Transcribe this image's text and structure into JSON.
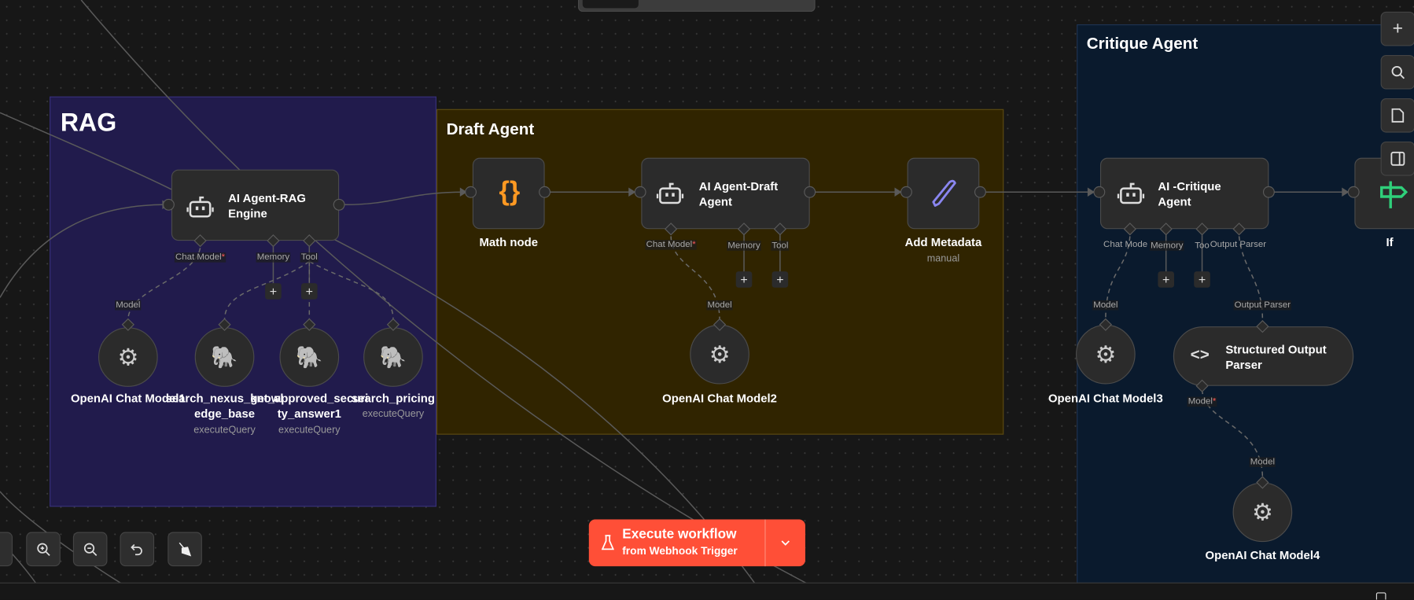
{
  "groups": {
    "rag": "RAG",
    "draft": "Draft Agent",
    "critique": "Critique Agent"
  },
  "nodes": {
    "rag_agent": {
      "title": "AI Agent-RAG Engine",
      "ports": {
        "chat_model": "Chat Model",
        "memory": "Memory",
        "tool": "Tool"
      }
    },
    "openai1": {
      "name": "OpenAI Chat Model1",
      "port": "Model"
    },
    "search_kb": {
      "name_l1": "search_nexus_knowl",
      "name_l2": "edge_base",
      "sub": "executeQuery"
    },
    "get_approved": {
      "name_l1": "get_approved_securi",
      "name_l2": "ty_answer1",
      "sub": "executeQuery"
    },
    "search_pricing": {
      "name": "search_pricing",
      "sub": "executeQuery"
    },
    "math": {
      "name": "Math node"
    },
    "draft_agent": {
      "title": "AI Agent-Draft Agent",
      "ports": {
        "chat_model": "Chat Model",
        "memory": "Memory",
        "tool": "Tool"
      }
    },
    "openai2": {
      "name": "OpenAI Chat Model2",
      "port": "Model"
    },
    "metadata": {
      "name": "Add Metadata",
      "sub": "manual"
    },
    "critique_agent": {
      "title": "AI -Critique Agent",
      "ports": {
        "chat_model": "Chat Mode",
        "memory": "Memory",
        "tool": "Too",
        "output_parser": "Output Parser"
      }
    },
    "openai3": {
      "name": "OpenAI Chat Model3",
      "port": "Model"
    },
    "parser": {
      "title": "Structured Output Parser",
      "port_in": "Output Parser",
      "port_model": "Model"
    },
    "openai4": {
      "name": "OpenAI Chat Model4",
      "port": "Model"
    },
    "if": {
      "name": "If"
    }
  },
  "required_mark": "*",
  "plus": "+",
  "execute": {
    "title": "Execute workflow",
    "subtitle": "from Webhook Trigger"
  },
  "colors": {
    "execute": "#ff4f37",
    "rag_bg": "#211b4c",
    "draft_bg": "#302400",
    "critique_bg": "#0a1a2d"
  }
}
